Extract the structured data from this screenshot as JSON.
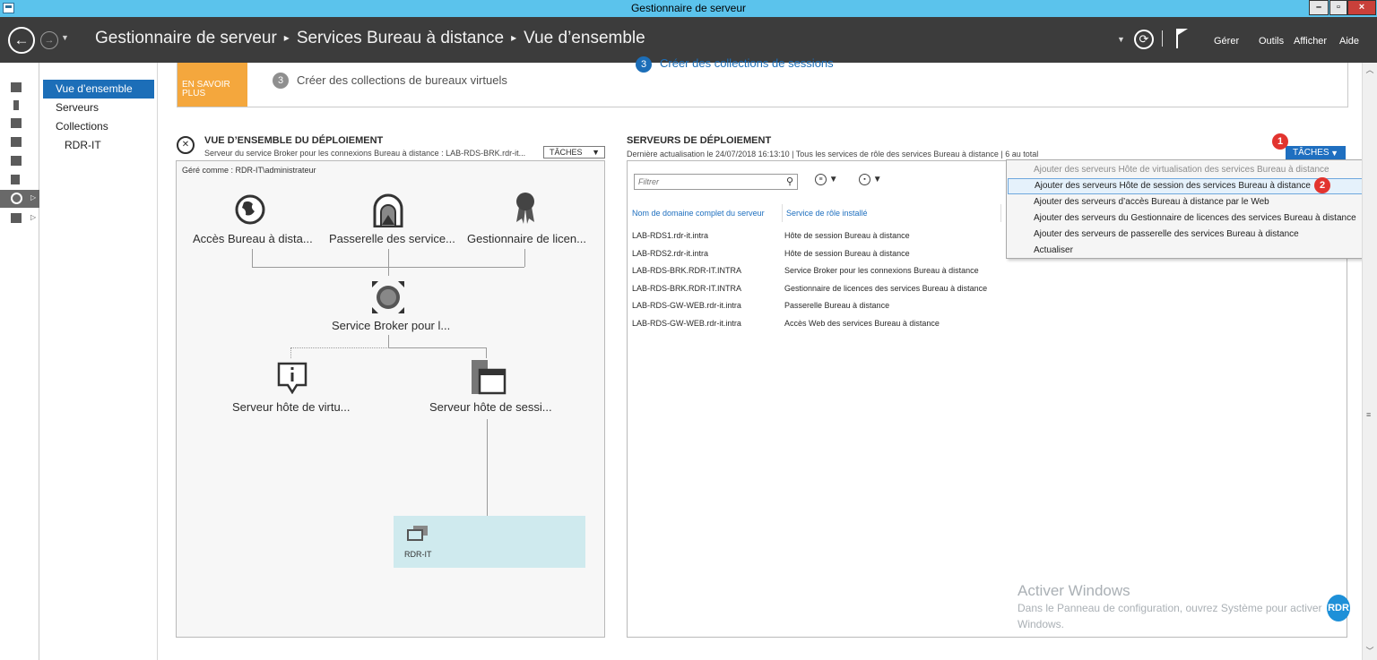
{
  "window": {
    "title": "Gestionnaire de serveur",
    "min_label": "–",
    "max_label": "▫",
    "close_label": "×"
  },
  "header": {
    "breadcrumb": [
      "Gestionnaire de serveur",
      "Services Bureau à distance",
      "Vue d’ensemble"
    ],
    "menu": [
      "Gérer",
      "Outils",
      "Afficher",
      "Aide"
    ]
  },
  "nav": {
    "items": [
      {
        "label": "Vue d’ensemble",
        "active": true
      },
      {
        "label": "Serveurs"
      },
      {
        "label": "Collections"
      },
      {
        "label": "RDR-IT"
      }
    ]
  },
  "learn": {
    "button_label": "EN SAVOIR PLUS",
    "step3a_num": "3",
    "step3a": "Créer des collections de bureaux virtuels",
    "step3b_num": "3",
    "step3b": "Créer des collections de sessions"
  },
  "overview": {
    "title": "VUE D’ENSEMBLE DU DÉPLOIEMENT",
    "subtitle": "Serveur du service Broker pour les connexions Bureau à distance : LAB-RDS-BRK.rdr-it...",
    "tasks_label": "TÂCHES",
    "managed_as": "Géré comme : RDR-IT\\administrateur",
    "roles": {
      "web_access": "Accès Bureau à dista...",
      "gateway": "Passerelle des service...",
      "licensing": "Gestionnaire de licen...",
      "broker": "Service Broker pour l...",
      "virtualization_host": "Serveur hôte de virtu...",
      "session_host": "Serveur hôte de sessi..."
    },
    "collection_tile": "RDR-IT"
  },
  "servers": {
    "title": "SERVEURS DE DÉPLOIEMENT",
    "subtitle": "Dernière actualisation le 24/07/2018 16:13:10 | Tous les services de rôle des services Bureau à distance  | 6 au total",
    "tasks_label": "TÂCHES",
    "filter_placeholder": "Filtrer",
    "columns": [
      "Nom de domaine complet du serveur",
      "Service de rôle installé"
    ],
    "rows": [
      [
        "LAB-RDS1.rdr-it.intra",
        "Hôte de session Bureau à distance"
      ],
      [
        "LAB-RDS2.rdr-it.intra",
        "Hôte de session Bureau à distance"
      ],
      [
        "LAB-RDS-BRK.RDR-IT.INTRA",
        "Service Broker pour les connexions Bureau à distance"
      ],
      [
        "LAB-RDS-BRK.RDR-IT.INTRA",
        "Gestionnaire de licences des services Bureau à distance"
      ],
      [
        "LAB-RDS-GW-WEB.rdr-it.intra",
        "Passerelle Bureau à distance"
      ],
      [
        "LAB-RDS-GW-WEB.rdr-it.intra",
        "Accès Web des services Bureau à distance"
      ]
    ]
  },
  "tasks_menu": {
    "items": [
      {
        "label": "Ajouter des serveurs Hôte de virtualisation des services Bureau à distance",
        "disabled": true
      },
      {
        "label": "Ajouter des serveurs Hôte de session des services Bureau à distance",
        "highlighted": true
      },
      {
        "label": "Ajouter des serveurs d’accès Bureau à distance par le Web"
      },
      {
        "label": "Ajouter des serveurs du Gestionnaire de licences des services Bureau à distance"
      },
      {
        "label": "Ajouter des serveurs de passerelle des services Bureau à distance"
      },
      {
        "label": "Actualiser"
      }
    ]
  },
  "badges": [
    "1",
    "2"
  ],
  "watermark": {
    "title": "Activer Windows",
    "text": "Dans le Panneau de configuration, ouvrez Système pour activer Windows.",
    "logo": "RDR"
  },
  "colors": {
    "header_bg": "#3c3c3c",
    "titlebar_bg": "#5bc3ec",
    "accent": "#1c6eb8",
    "learn_orange": "#f4a73d",
    "badge_red": "#e2342f"
  }
}
